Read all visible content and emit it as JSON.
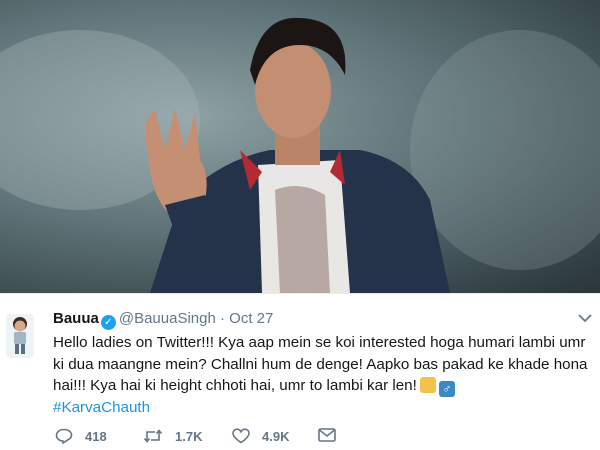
{
  "tweet": {
    "name": "Bauua",
    "handle": "@BauuaSingh",
    "separator": "·",
    "date": "Oct 27",
    "lines": [
      "Hello ladies on Twitter!!! Kya aap mein se koi interested hoga  humari lambi umr",
      "ki dua maangne mein? Challni hum de denge! Aapko bas pakad ke khade hona",
      "hai!!! Kya hai ki height chhoti hai, umr to lambi kar len!"
    ],
    "hashtag": "#KarvaChauth",
    "icons": [
      "verified-icon",
      "woman-tipping-hand-emoji",
      "male-sign-emoji",
      "chevron-down-icon"
    ]
  },
  "actions": {
    "reply_count": "418",
    "retweet_count": "1.7K",
    "like_count": "4.9K"
  },
  "colors": {
    "link": "#1b95e0",
    "verified": "#1da1f2",
    "muted": "#657786"
  }
}
